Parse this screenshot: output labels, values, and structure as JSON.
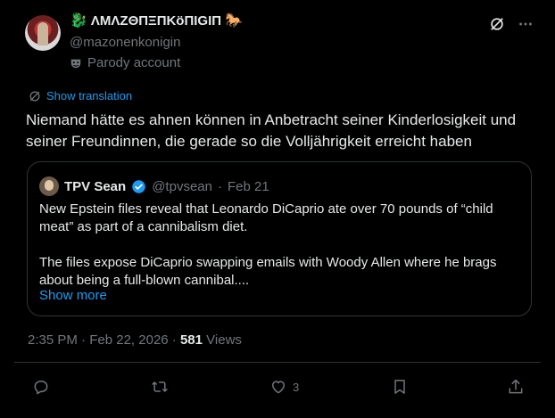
{
  "author": {
    "display_name": "ΛMΛZΘПΞПKӧПIGIП",
    "handle": "@mazonenkonigin",
    "parody_label": "Parody account",
    "emoji_left": "🐉",
    "emoji_right": "🐎"
  },
  "translate": {
    "label": "Show translation"
  },
  "tweet": {
    "text": "Niemand hätte es ahnen können in Anbetracht seiner Kinderlosigkeit und seiner Freundinnen, die gerade so die Volljährigkeit erreicht haben"
  },
  "quote": {
    "name": "TPV Sean",
    "handle": "@tpvsean",
    "separator": "·",
    "date": "Feb 21",
    "paragraph1": "New Epstein files reveal that Leonardo DiCaprio ate over 70 pounds of “child meat” as part of a cannibalism diet.",
    "paragraph2": "The files expose DiCaprio swapping emails with Woody Allen where he brags about being a full-blown cannibal....",
    "show_more": "Show more"
  },
  "meta": {
    "time": "2:35 PM",
    "separator": "·",
    "date": "Feb 22, 2026",
    "views_count": "581",
    "views_label": "Views"
  },
  "actions": {
    "like_count": "3"
  },
  "colors": {
    "background": "#000000",
    "text": "#e7e9ea",
    "muted": "#71767b",
    "accent": "#1d9bf0",
    "border": "#2f3336"
  },
  "icons": [
    "grok-icon",
    "more-icon",
    "parody-mask-icon",
    "translate-icon",
    "verified-badge-icon",
    "reply-icon",
    "retweet-icon",
    "like-icon",
    "bookmark-icon",
    "share-icon"
  ]
}
